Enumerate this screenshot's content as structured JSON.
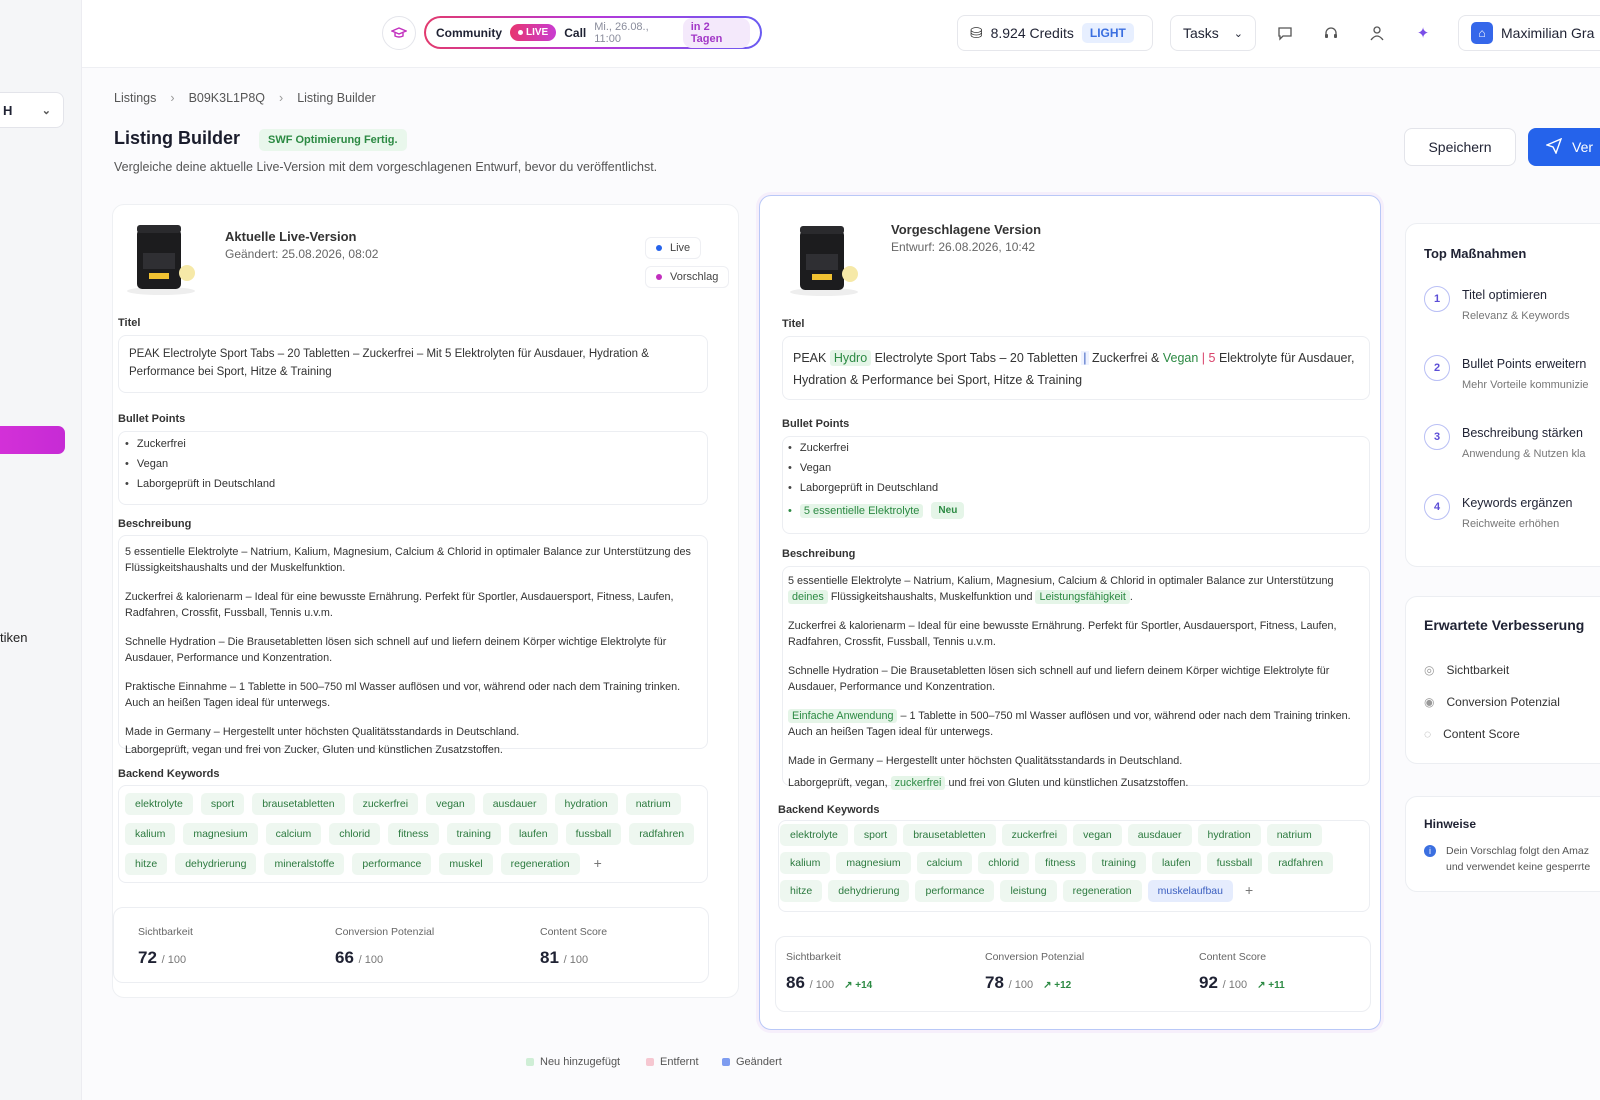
{
  "sidebar": {
    "select_value": "H",
    "nav_label": "tiken"
  },
  "topbar": {
    "community": {
      "label": "Community",
      "live": "LIVE",
      "call": "Call",
      "date": "Mi., 26.08., 11:00",
      "in": "in 2 Tagen"
    },
    "credits": "8.924 Credits",
    "plan": "LIGHT",
    "tasks": "Tasks",
    "user": "Maximilian Gra"
  },
  "breadcrumb": [
    "Listings",
    "B09K3L1P8Q",
    "Listing Builder"
  ],
  "page": {
    "title": "Listing Builder",
    "badge": "SWF Optimierung Fertig.",
    "subtitle": "Vergleiche deine aktuelle Live-Version mit dem vorgeschlagenen Entwurf, bevor du veröffentlichst.",
    "save": "Speichern",
    "publish": "Ver"
  },
  "current": {
    "heading": "Aktuelle Live-Version",
    "changed": "Geändert: 25.08.2026, 08:02",
    "legend_live": "Live",
    "legend_suggest": "Vorschlag",
    "title_label": "Titel",
    "title_text": "PEAK Electrolyte Sport Tabs – 20 Tabletten – Zuckerfrei – Mit 5 Elektrolyten für Ausdauer, Hydration & Performance bei Sport, Hitze & Training",
    "bullets_label": "Bullet Points",
    "bullets": [
      "Zuckerfrei",
      "Vegan",
      "Laborgeprüft in Deutschland"
    ],
    "desc_label": "Beschreibung",
    "desc": [
      "5 essentielle Elektrolyte – Natrium, Kalium, Magnesium, Calcium & Chlorid in optimaler Balance zur Unterstützung des Flüssigkeitshaushalts und der Muskelfunktion.",
      "Zuckerfrei & kalorienarm – Ideal für eine bewusste Ernährung. Perfekt für Sportler, Ausdauersport, Fitness, Laufen, Radfahren, Crossfit, Fussball, Tennis u.v.m.",
      "Schnelle Hydration – Die Brausetabletten lösen sich schnell auf und liefern deinem Körper wichtige Elektrolyte für Ausdauer, Performance und Konzentration.",
      "Praktische Einnahme – 1 Tablette in 500–750 ml Wasser auflösen und vor, während oder nach dem Training trinken. Auch an heißen Tagen ideal für unterwegs.",
      "Made in Germany – Hergestellt unter höchsten Qualitätsstandards in Deutschland.",
      "Laborgeprüft, vegan und frei von Zucker, Gluten und künstlichen Zusatzstoffen."
    ],
    "kw_label": "Backend Keywords",
    "keywords": [
      "elektrolyte",
      "sport",
      "brausetabletten",
      "zuckerfrei",
      "vegan",
      "ausdauer",
      "hydration",
      "natrium",
      "kalium",
      "magnesium",
      "calcium",
      "chlorid",
      "fitness",
      "training",
      "laufen",
      "fussball",
      "radfahren",
      "hitze",
      "dehydrierung",
      "mineralstoffe",
      "performance",
      "muskel",
      "regeneration"
    ],
    "scores": [
      {
        "label": "Sichtbarkeit",
        "value": "72",
        "of": "/ 100"
      },
      {
        "label": "Conversion Potenzial",
        "value": "66",
        "of": "/ 100"
      },
      {
        "label": "Content Score",
        "value": "81",
        "of": "/ 100"
      }
    ]
  },
  "proposed": {
    "heading": "Vorgeschlagene Version",
    "draft": "Entwurf: 26.08.2026, 10:42",
    "title_label": "Titel",
    "title_parts": [
      "PEAK ",
      "Hydro",
      " Electrolyte Sport Tabs – 20 Tabletten ",
      "|",
      " Zuckerfrei & ",
      "Vegan",
      " ",
      "| 5",
      " Elektrolyte für Ausdauer, Hydration & Performance bei Sport, Hitze & Training"
    ],
    "bullets_label": "Bullet Points",
    "bullets": [
      "Zuckerfrei",
      "Vegan",
      "Laborgeprüft in Deutschland"
    ],
    "bullet_new": "5 essentielle Elektrolyte",
    "new_badge": "Neu",
    "desc_label": "Beschreibung",
    "desc": {
      "p1a": "5 essentielle Elektrolyte – Natrium, Kalium, Magnesium, Calcium & Chlorid in optimaler Balance zur Unterstützung ",
      "p1b": "deines",
      "p1c": " Flüssigkeitshaushalts, Muskelfunktion und ",
      "p1d": "Leistungsfähigkeit",
      "p1e": ".",
      "p2": "Zuckerfrei & kalorienarm – Ideal für eine bewusste Ernährung. Perfekt für Sportler, Ausdauersport, Fitness, Laufen, Radfahren, Crossfit, Fussball, Tennis u.v.m.",
      "p3": "Schnelle Hydration – Die Brausetabletten lösen sich schnell auf und liefern deinem Körper wichtige Elektrolyte für Ausdauer, Performance und Konzentration.",
      "p4a": "Einfache Anwendung",
      "p4b": " – 1 Tablette in 500–750 ml Wasser auflösen und vor, während oder nach dem Training trinken. Auch an heißen Tagen ideal für unterwegs.",
      "p5": "Made in Germany – Hergestellt unter höchsten Qualitätsstandards in Deutschland.",
      "p6a": "Laborgeprüft, vegan, ",
      "p6b": "zuckerfrei",
      "p6c": " und frei von Gluten und künstlichen Zusatzstoffen."
    },
    "kw_label": "Backend Keywords",
    "keywords": [
      "elektrolyte",
      "sport",
      "brausetabletten",
      "zuckerfrei",
      "vegan",
      "ausdauer",
      "hydration",
      "natrium",
      "kalium",
      "magnesium",
      "calcium",
      "chlorid",
      "fitness",
      "training",
      "laufen",
      "fussball",
      "radfahren",
      "hitze",
      "dehydrierung",
      "performance",
      "leistung",
      "regeneration"
    ],
    "keyword_new": "muskelaufbau",
    "scores": [
      {
        "label": "Sichtbarkeit",
        "value": "86",
        "of": "/ 100",
        "delta": "↗ +14"
      },
      {
        "label": "Conversion Potenzial",
        "value": "78",
        "of": "/ 100",
        "delta": "↗ +12"
      },
      {
        "label": "Content Score",
        "value": "92",
        "of": "/ 100",
        "delta": "↗ +11"
      }
    ]
  },
  "top_actions": {
    "title": "Top Maßnahmen",
    "items": [
      {
        "n": "1",
        "title": "Titel optimieren",
        "sub": "Relevanz & Keywords"
      },
      {
        "n": "2",
        "title": "Bullet Points erweitern",
        "sub": "Mehr Vorteile kommunizie"
      },
      {
        "n": "3",
        "title": "Beschreibung stärken",
        "sub": "Anwendung & Nutzen kla"
      },
      {
        "n": "4",
        "title": "Keywords ergänzen",
        "sub": "Reichweite erhöhen"
      }
    ]
  },
  "improvement": {
    "title": "Erwartete Verbesserung",
    "items": [
      "Sichtbarkeit",
      "Conversion Potenzial",
      "Content Score"
    ]
  },
  "hints": {
    "title": "Hinweise",
    "text": "Dein Vorschlag folgt den Amaz und verwendet keine gesperrte"
  },
  "footer_legend": [
    "Neu hinzugefügt",
    "Entfernt",
    "Geändert"
  ],
  "colors": {
    "accent": "#2563eb",
    "added": "#2c8a43",
    "removed": "#e0556d",
    "changed": "#3b6fe0",
    "brand": "#c22fbe"
  }
}
